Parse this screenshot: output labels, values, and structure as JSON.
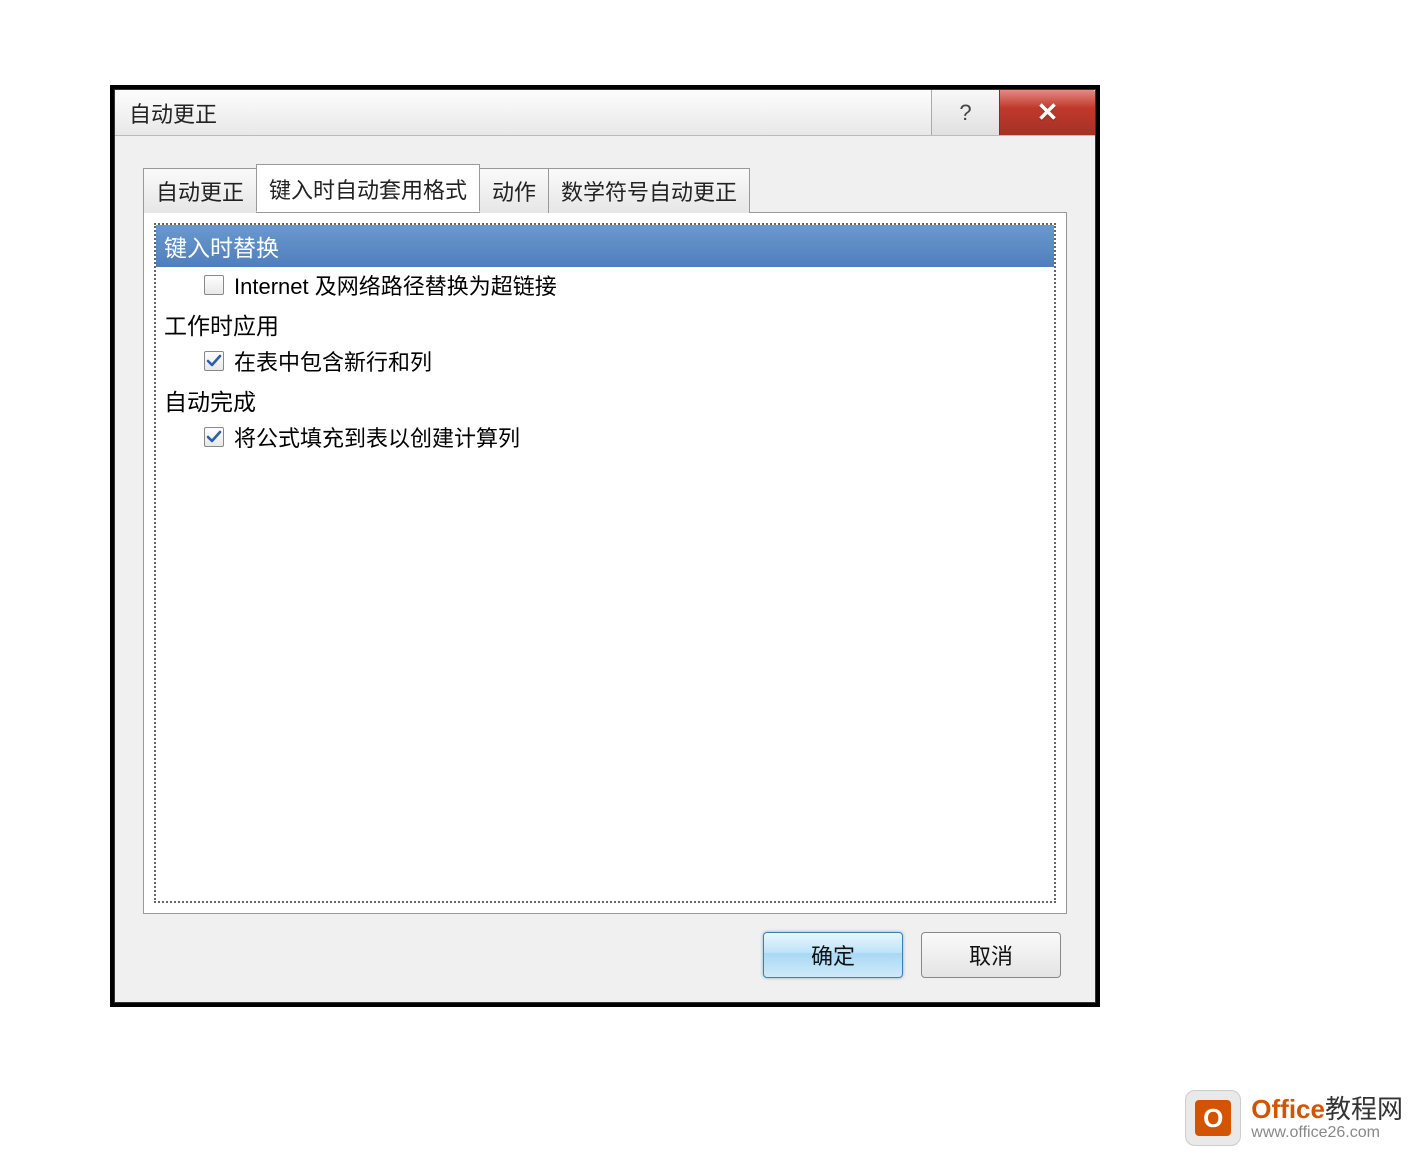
{
  "dialog": {
    "title": "自动更正",
    "tabs": [
      {
        "label": "自动更正",
        "active": false
      },
      {
        "label": "键入时自动套用格式",
        "active": true
      },
      {
        "label": "动作",
        "active": false
      },
      {
        "label": "数学符号自动更正",
        "active": false
      }
    ],
    "groups": {
      "replace_as_type": {
        "header": "键入时替换"
      },
      "apply_as_work": {
        "label": "工作时应用"
      },
      "auto_complete": {
        "label": "自动完成"
      }
    },
    "options": {
      "internet_paths": {
        "label": "Internet 及网络路径替换为超链接",
        "checked": false
      },
      "include_new_rows": {
        "label": "在表中包含新行和列",
        "checked": true
      },
      "fill_formulas": {
        "label": "将公式填充到表以创建计算列",
        "checked": true
      }
    },
    "buttons": {
      "ok": "确定",
      "cancel": "取消"
    }
  },
  "watermark": {
    "brand_en": "Office",
    "brand_cn": "教程网",
    "url": "www.office26.com",
    "badge_letter": "O"
  }
}
